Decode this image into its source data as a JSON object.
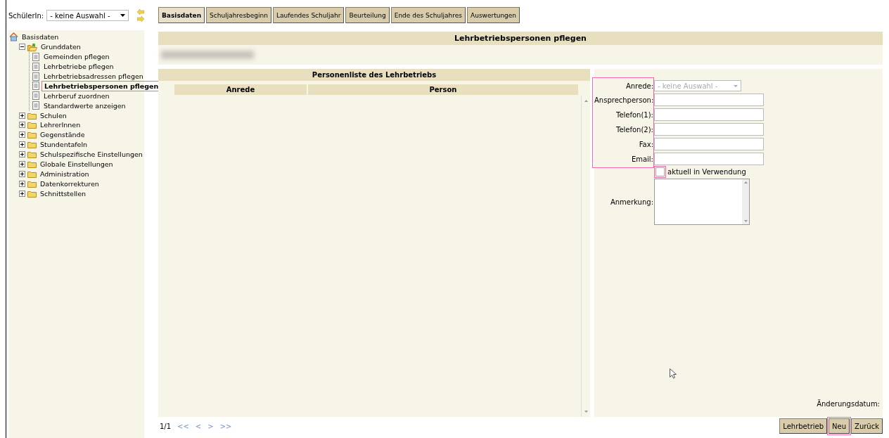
{
  "student_selector": {
    "label": "SchülerIn:",
    "value": "- keine Auswahl -"
  },
  "tabs": [
    {
      "label": "Basisdaten",
      "selected": true
    },
    {
      "label": "Schuljahresbeginn",
      "selected": false
    },
    {
      "label": "Laufendes Schuljahr",
      "selected": false
    },
    {
      "label": "Beurteilung",
      "selected": false
    },
    {
      "label": "Ende des Schuljahres",
      "selected": false
    },
    {
      "label": "Auswertungen",
      "selected": false
    }
  ],
  "tree": [
    {
      "label": "Basisdaten",
      "kind": "home",
      "children": [
        {
          "label": "Grunddaten",
          "kind": "folder",
          "expanded": true,
          "children": [
            {
              "label": "Gemeinden pflegen",
              "kind": "page",
              "selected": false
            },
            {
              "label": "Lehrbetriebe pflegen",
              "kind": "page",
              "selected": false
            },
            {
              "label": "Lehrbetriebsadressen pflegen",
              "kind": "page",
              "selected": false
            },
            {
              "label": "Lehrbetriebspersonen pflegen",
              "kind": "page",
              "selected": true
            },
            {
              "label": "Lehrberuf zuordnen",
              "kind": "page",
              "selected": false
            },
            {
              "label": "Standardwerte anzeigen",
              "kind": "page",
              "selected": false
            }
          ]
        },
        {
          "label": "Schulen",
          "kind": "folder",
          "expanded": false
        },
        {
          "label": "LehrerInnen",
          "kind": "folder",
          "expanded": false
        },
        {
          "label": "Gegenstände",
          "kind": "folder",
          "expanded": false
        },
        {
          "label": "Stundentafeln",
          "kind": "folder",
          "expanded": false
        },
        {
          "label": "Schulspezifische Einstellungen",
          "kind": "folder",
          "expanded": false
        },
        {
          "label": "Globale Einstellungen",
          "kind": "folder",
          "expanded": false
        },
        {
          "label": "Administration",
          "kind": "folder",
          "expanded": false
        },
        {
          "label": "Datenkorrekturen",
          "kind": "folder",
          "expanded": false
        },
        {
          "label": "Schnittstellen",
          "kind": "folder",
          "expanded": false
        }
      ]
    }
  ],
  "page_title": "Lehrbetriebspersonen pflegen",
  "person_list": {
    "title": "Personenliste des Lehrbetriebs",
    "columns": [
      "Anrede",
      "Person"
    ]
  },
  "form": {
    "fields": [
      {
        "label": "Anrede:",
        "kind": "select",
        "value": "- keine Auswahl -",
        "disabled": true
      },
      {
        "label": "Ansprechperson:",
        "kind": "text"
      },
      {
        "label": "Telefon(1):",
        "kind": "text"
      },
      {
        "label": "Telefon(2):",
        "kind": "text"
      },
      {
        "label": "Fax:",
        "kind": "text"
      },
      {
        "label": "Email:",
        "kind": "text"
      }
    ],
    "checkbox": {
      "label": "aktuell in Verwendung",
      "checked": false
    },
    "remark_label": "Anmerkung:",
    "changed_label": "Änderungsdatum:"
  },
  "pager": {
    "page": "1/1",
    "links": [
      "<<",
      "<",
      ">",
      ">>"
    ]
  },
  "buttons": [
    "Lehrbetrieb",
    "Neu",
    "Zurück"
  ]
}
